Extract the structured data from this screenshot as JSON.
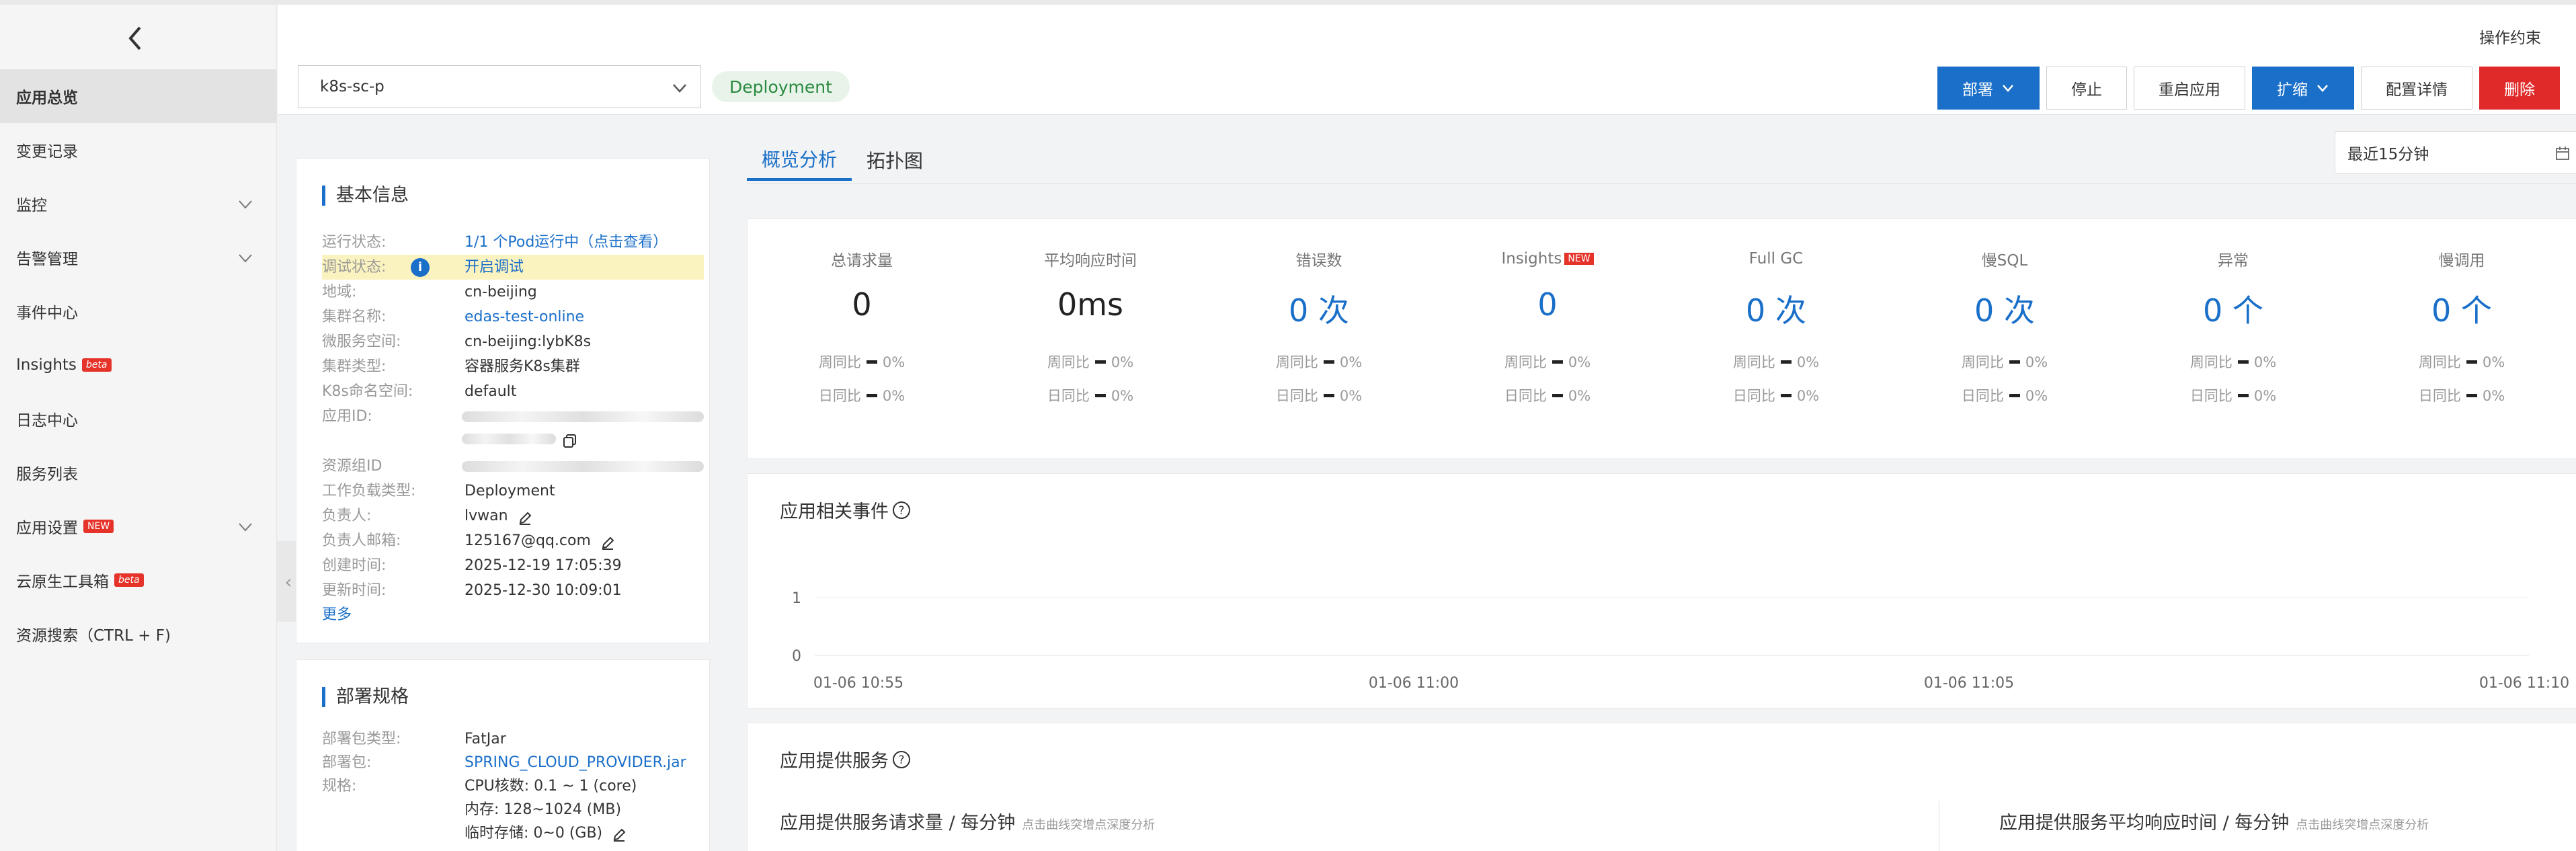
{
  "sidebar": {
    "items": [
      {
        "label": "应用总览",
        "active": true,
        "chevron": false,
        "tag": ""
      },
      {
        "label": "变更记录",
        "active": false,
        "chevron": false,
        "tag": ""
      },
      {
        "label": "监控",
        "active": false,
        "chevron": true,
        "tag": ""
      },
      {
        "label": "告警管理",
        "active": false,
        "chevron": true,
        "tag": ""
      },
      {
        "label": "事件中心",
        "active": false,
        "chevron": false,
        "tag": ""
      },
      {
        "label": "Insights",
        "active": false,
        "chevron": false,
        "tag": "beta"
      },
      {
        "label": "日志中心",
        "active": false,
        "chevron": false,
        "tag": ""
      },
      {
        "label": "服务列表",
        "active": false,
        "chevron": false,
        "tag": ""
      },
      {
        "label": "应用设置",
        "active": false,
        "chevron": true,
        "tag": "NEW"
      },
      {
        "label": "云原生工具箱",
        "active": false,
        "chevron": false,
        "tag": "beta"
      },
      {
        "label": "资源搜索（CTRL + F)",
        "active": false,
        "chevron": false,
        "tag": ""
      }
    ]
  },
  "header": {
    "ops_label": "操作约束",
    "app_name": "k8s-sc-p",
    "kind_badge": "Deployment",
    "buttons": {
      "deploy": "部署",
      "stop": "停止",
      "restart": "重启应用",
      "scale": "扩缩",
      "config": "配置详情",
      "delete": "删除"
    }
  },
  "basic_info": {
    "title": "基本信息",
    "rows": [
      {
        "k": "运行状态:",
        "v": "1/1 个Pod运行中（点击查看）"
      },
      {
        "k": "调试状态:",
        "v": "开启调试"
      },
      {
        "k": "地域:",
        "v": "cn-beijing"
      },
      {
        "k": "集群名称:",
        "v": "edas-test-online"
      },
      {
        "k": "微服务空间:",
        "v": "cn-beijing:lybK8s"
      },
      {
        "k": "集群类型:",
        "v": "容器服务K8s集群"
      },
      {
        "k": "K8s命名空间:",
        "v": "default"
      },
      {
        "k": "应用ID:",
        "v": ""
      },
      {
        "k": "资源组ID",
        "v": ""
      },
      {
        "k": "工作负载类型:",
        "v": "Deployment"
      },
      {
        "k": "负责人:",
        "v": "lvwan"
      },
      {
        "k": "负责人邮箱:",
        "v": "125167@qq.com"
      },
      {
        "k": "创建时间:",
        "v": "2025-12-19 17:05:39"
      },
      {
        "k": "更新时间:",
        "v": "2025-12-30 10:09:01"
      }
    ],
    "more": "更多"
  },
  "deploy_spec": {
    "title": "部署规格",
    "rows": [
      {
        "k": "部署包类型:",
        "v": "FatJar"
      },
      {
        "k": "部署包:",
        "v": "SPRING_CLOUD_PROVIDER.jar"
      },
      {
        "k": "规格:",
        "v": "CPU核数:   0.1 ~ 1 (core)"
      },
      {
        "k": "",
        "v": "内存:   128~1024 (MB)"
      },
      {
        "k": "",
        "v": "临时存储:   0~0 (GB)"
      }
    ]
  },
  "tabs": [
    "概览分析",
    "拓扑图"
  ],
  "time_range": "最近15分钟",
  "metrics": [
    {
      "label": "总请求量",
      "value": "0",
      "blue": false,
      "new": false
    },
    {
      "label": "平均响应时间",
      "value": "0ms",
      "blue": false,
      "new": false
    },
    {
      "label": "错误数",
      "value": "0 次",
      "blue": true,
      "new": false
    },
    {
      "label": "Insights",
      "value": "0",
      "blue": true,
      "new": true
    },
    {
      "label": "Full GC",
      "value": "0 次",
      "blue": true,
      "new": false
    },
    {
      "label": "慢SQL",
      "value": "0 次",
      "blue": true,
      "new": false
    },
    {
      "label": "异常",
      "value": "0 个",
      "blue": true,
      "new": false
    },
    {
      "label": "慢调用",
      "value": "0 个",
      "blue": true,
      "new": false
    }
  ],
  "compare": {
    "week_label": "周同比",
    "day_label": "日同比",
    "value": "0%",
    "new_tag": "NEW"
  },
  "events": {
    "title": "应用相关事件",
    "chart_data": {
      "type": "line",
      "x": [
        "01-06 10:55",
        "01-06 11:00",
        "01-06 11:05",
        "01-06 11:10"
      ],
      "y_ticks": [
        "1",
        "0"
      ],
      "ylim": [
        0,
        1
      ],
      "series": []
    }
  },
  "services": {
    "title": "应用提供服务",
    "left_chart": "应用提供服务请求量 / 每分钟",
    "right_chart": "应用提供服务平均响应时间 / 每分钟",
    "hint": "点击曲线突增点深度分析"
  }
}
